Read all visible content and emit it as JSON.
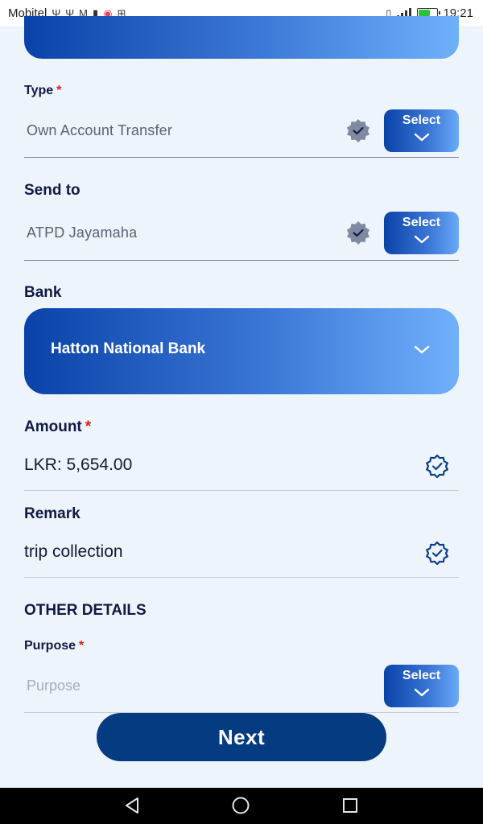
{
  "status_bar": {
    "carrier": "Mobitel",
    "time": "19:21",
    "icons": [
      "usb-icon",
      "usb-icon",
      "gmail-icon",
      "notification-icon",
      "record-icon",
      "add-icon",
      "vibrate-icon",
      "signal-icon",
      "battery-icon"
    ],
    "battery_color": "#2ec23a"
  },
  "form": {
    "type": {
      "label": "Type",
      "required_mark": "*",
      "value": "Own Account Transfer",
      "select_label": "Select"
    },
    "send_to": {
      "label": "Send to",
      "value": "ATPD Jayamaha",
      "select_label": "Select"
    },
    "bank": {
      "label": "Bank",
      "value": "Hatton National Bank"
    },
    "amount": {
      "label": "Amount",
      "required_mark": "*",
      "value": "LKR: 5,654.00"
    },
    "remark": {
      "label": "Remark",
      "value": "trip collection"
    },
    "other_details": {
      "title": "OTHER DETAILS"
    },
    "purpose": {
      "label": "Purpose",
      "required_mark": "*",
      "placeholder": "Purpose",
      "select_label": "Select"
    }
  },
  "actions": {
    "next_label": "Next"
  },
  "colors": {
    "brand_dark": "#053b80",
    "gradient_start": "#0a43a8",
    "gradient_end": "#6fb0fb",
    "required": "#e31b1b",
    "background": "#eef4fc"
  }
}
